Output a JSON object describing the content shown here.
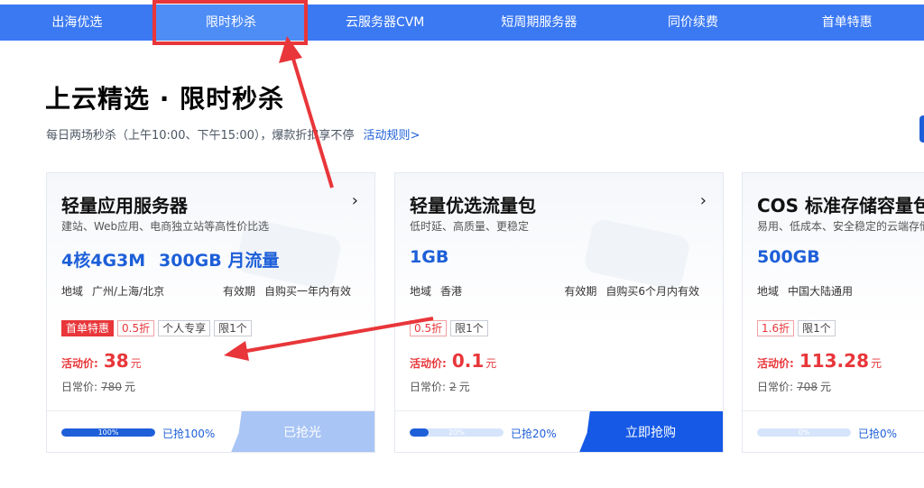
{
  "nav": {
    "items": [
      "出海优选",
      "限时秒杀",
      "云服务器CVM",
      "短周期服务器",
      "同价续费",
      "首单特惠"
    ],
    "active_index": 1
  },
  "page": {
    "title": "上云精选 · 限时秒杀",
    "subtitle": "每日两场秒杀（上午10:00、下午15:00），爆款折扣享不停",
    "rules_link": "活动规则>"
  },
  "labels": {
    "region": "地域",
    "validity": "有效期",
    "promo": "活动价:",
    "regular": "日常价:",
    "unit": "元"
  },
  "cards": [
    {
      "name": "轻量应用服务器",
      "desc": "建站、Web应用、电商独立站等高性价比选",
      "spec": "4核4G3M",
      "spec2": "300GB 月流量",
      "region": "广州/上海/北京",
      "validity": "自购买一年内有效",
      "tags": [
        "首单特惠",
        "0.5折",
        "个人专享",
        "限1个"
      ],
      "promo_price": "38",
      "regular_price": "780",
      "progress_pct": 100,
      "progress_label": "100%",
      "grabbed": "已抢100%",
      "action": "已抢光"
    },
    {
      "name": "轻量优选流量包",
      "desc": "低时延、高质量、更稳定",
      "spec": "1GB",
      "region": "香港",
      "validity": "自购买6个月内有效",
      "tags": [
        "0.5折",
        "限1个"
      ],
      "promo_price": "0.1",
      "regular_price": "2",
      "progress_pct": 20,
      "progress_label": "20%",
      "grabbed": "已抢20%",
      "action": "立即抢购"
    },
    {
      "name": "COS 标准存储容量包",
      "desc": "易用、低成本、安全稳定的云端存储",
      "spec": "500GB",
      "region": "中国大陆通用",
      "tags": [
        "1.6折",
        "限1个"
      ],
      "promo_price": "113.28",
      "regular_price": "708",
      "progress_pct": 0,
      "progress_label": "0%",
      "grabbed": "已抢0%"
    }
  ],
  "colors": {
    "accent": "#3b79f3",
    "brand_blue": "#1d5fd8",
    "annotation_red": "#e8363a"
  }
}
